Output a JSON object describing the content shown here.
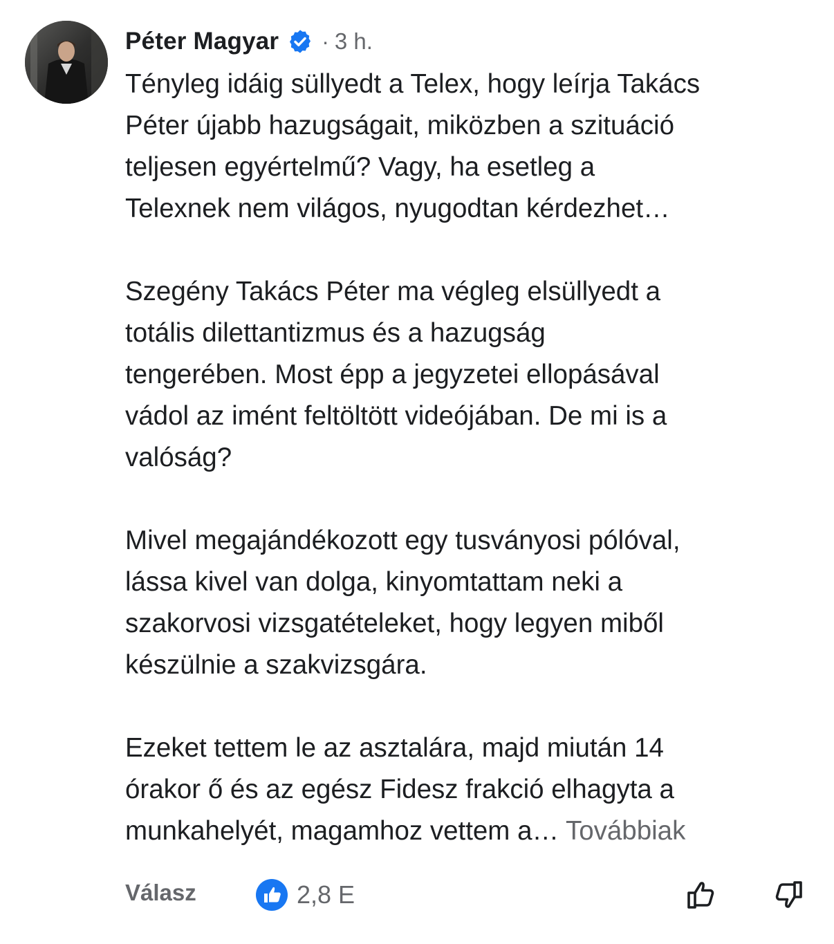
{
  "comment": {
    "author": "Péter Magyar",
    "verified": true,
    "time_separator": "·",
    "time_ago": "3 h.",
    "paragraphs": [
      "Tényleg idáig süllyedt a Telex, hogy leírja Takács\nPéter újabb hazugságait, miközben a szituáció\nteljesen egyértelmű? Vagy, ha esetleg a\nTelexnek nem világos, nyugodtan kérdezhet…",
      "Szegény Takács Péter ma végleg elsüllyedt a\ntotális dilettantizmus és a hazugság\ntengerében. Most épp a jegyzetei ellopásával\nvádol az imént feltöltött videójában. De mi is a\nvalóság?",
      "Mivel megajándékozott egy tusványosi pólóval,\nlássa kivel van dolga, kinyomtattam neki a\nszakorvosi  vizsgatételeket, hogy legyen miből\nkészülnie a szakvizsgára.",
      "Ezeket tettem le az asztalára, majd miután 14\nórakor ő és az egész Fidesz frakció elhagyta a\nmunkahelyét, magamhoz vettem a… "
    ],
    "see_more": "Továbbiak"
  },
  "actions": {
    "reply_label": "Válasz",
    "reaction_icon": "like-reaction-icon",
    "reaction_count": "2,8 E",
    "like_icon": "thumbs-up-outline-icon",
    "dislike_icon": "thumbs-down-outline-icon"
  },
  "colors": {
    "text": "#1c1e21",
    "secondary": "#65676b",
    "verified_blue": "#1877f2",
    "reaction_blue": "#1877f2"
  }
}
